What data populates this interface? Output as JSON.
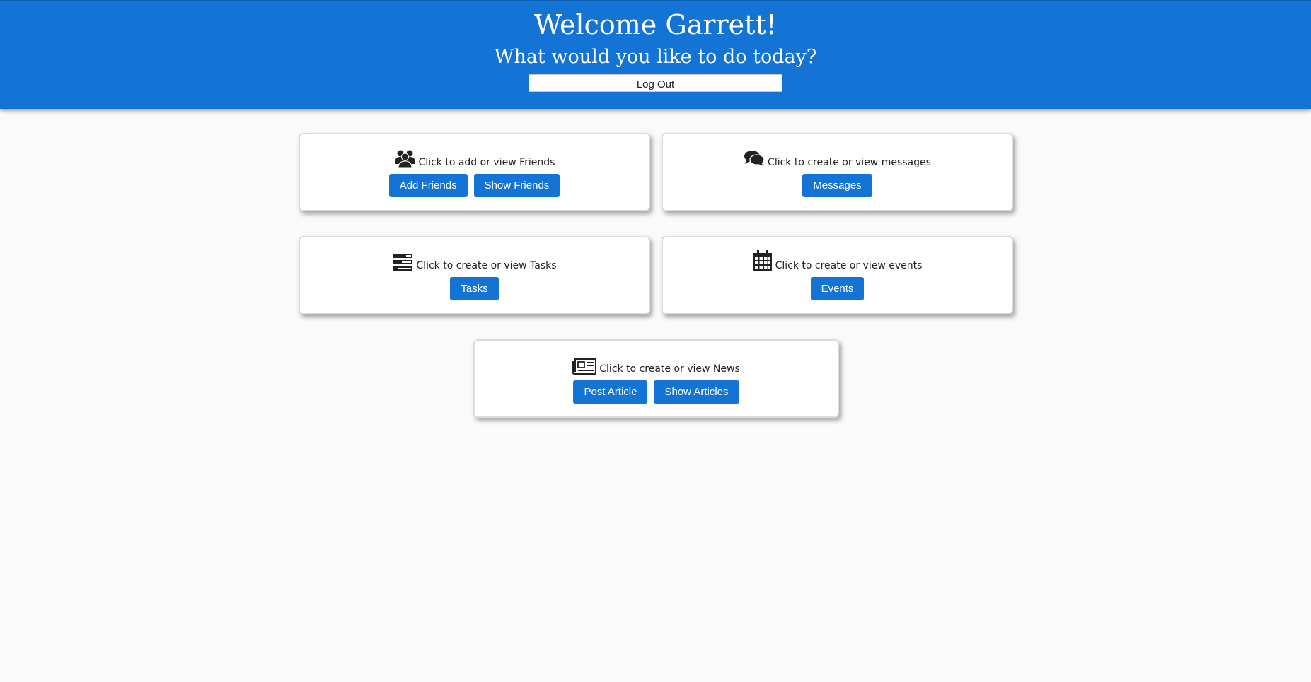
{
  "header": {
    "welcome": "Welcome Garrett!",
    "subtitle": "What would you like to do today?",
    "logout_label": "Log Out",
    "background": "#1474d6"
  },
  "cards": {
    "friends": {
      "icon": "users-icon",
      "text": "Click to add or view Friends",
      "buttons": [
        "Add Friends",
        "Show Friends"
      ]
    },
    "messages": {
      "icon": "comments-icon",
      "text": "Click to create or view messages",
      "buttons": [
        "Messages"
      ]
    },
    "tasks": {
      "icon": "tasks-icon",
      "text": "Click to create or view Tasks",
      "buttons": [
        "Tasks"
      ]
    },
    "events": {
      "icon": "calendar-icon",
      "text": "Click to create or view events",
      "buttons": [
        "Events"
      ]
    },
    "news": {
      "icon": "newspaper-icon",
      "text": "Click to create or view News",
      "buttons": [
        "Post Article",
        "Show Articles"
      ]
    }
  },
  "colors": {
    "accent": "#1474d6",
    "page_background": "#fafafa"
  }
}
